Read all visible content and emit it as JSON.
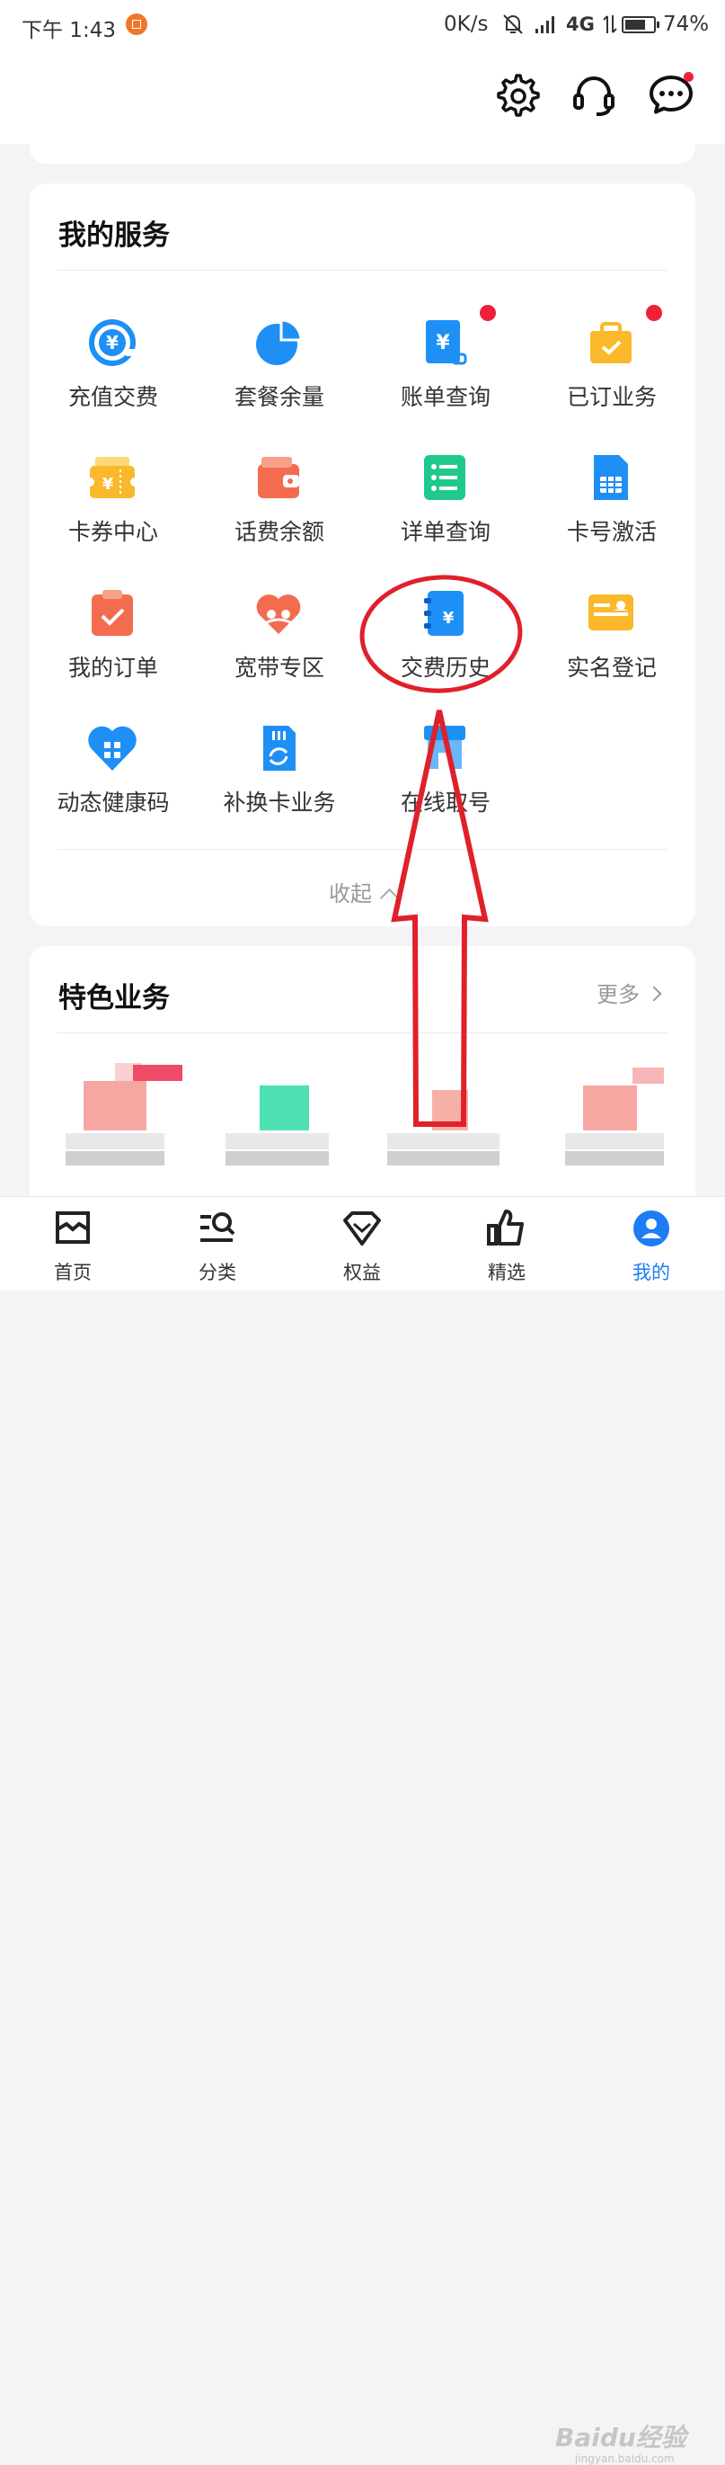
{
  "status_bar": {
    "time": "下午 1:43",
    "speed": "0K/s",
    "network": "4G",
    "battery_percent": "74%",
    "battery_level": 0.74
  },
  "header": {
    "icons": [
      "gear-icon",
      "headset-icon",
      "message-icon"
    ]
  },
  "services": {
    "title": "我的服务",
    "items": [
      {
        "label": "充值交费",
        "icon": "recharge-icon",
        "badge": false
      },
      {
        "label": "套餐余量",
        "icon": "pie-chart-icon",
        "badge": false
      },
      {
        "label": "账单查询",
        "icon": "bill-icon",
        "badge": true
      },
      {
        "label": "已订业务",
        "icon": "briefcase-icon",
        "badge": true
      },
      {
        "label": "卡券中心",
        "icon": "coupon-icon",
        "badge": false
      },
      {
        "label": "话费余额",
        "icon": "wallet-icon",
        "badge": false
      },
      {
        "label": "详单查询",
        "icon": "list-icon",
        "badge": false
      },
      {
        "label": "卡号激活",
        "icon": "sim-card-icon",
        "badge": false
      },
      {
        "label": "我的订单",
        "icon": "order-icon",
        "badge": false
      },
      {
        "label": "宽带专区",
        "icon": "broadband-heart-icon",
        "badge": false
      },
      {
        "label": "交费历史",
        "icon": "payment-history-icon",
        "badge": false
      },
      {
        "label": "实名登记",
        "icon": "id-card-icon",
        "badge": false
      },
      {
        "label": "动态健康码",
        "icon": "health-code-icon",
        "badge": false
      },
      {
        "label": "补换卡业务",
        "icon": "sim-replace-icon",
        "badge": false
      },
      {
        "label": "在线取号",
        "icon": "store-icon",
        "badge": false
      }
    ],
    "collapse_label": "收起"
  },
  "featured": {
    "title": "特色业务",
    "more_label": "更多"
  },
  "bottom_nav": {
    "items": [
      {
        "label": "首页",
        "icon": "home-icon"
      },
      {
        "label": "分类",
        "icon": "category-search-icon"
      },
      {
        "label": "权益",
        "icon": "diamond-icon"
      },
      {
        "label": "精选",
        "icon": "thumbs-up-icon"
      },
      {
        "label": "我的",
        "icon": "user-icon"
      }
    ],
    "active_index": 4
  },
  "watermark": {
    "brand": "Baidu经验",
    "url": "jingyan.baidu.com"
  },
  "colors": {
    "primary_blue": "#1e7cf5",
    "annotation_red": "#e0202a",
    "badge_red": "#f0203a"
  }
}
